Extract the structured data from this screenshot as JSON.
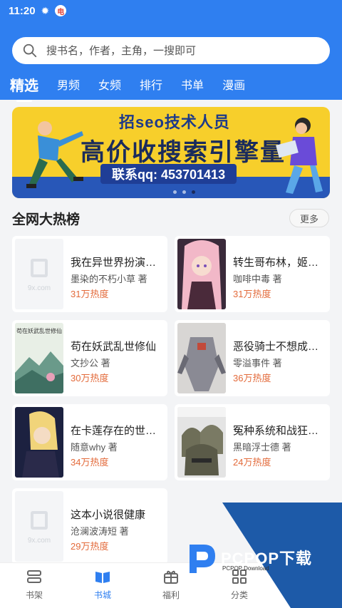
{
  "status": {
    "time": "11:20",
    "icon1": "flame-icon",
    "badge": "电"
  },
  "search": {
    "placeholder": "搜书名，作者，主角，一搜即可"
  },
  "tabs": [
    {
      "label": "精选",
      "active": true
    },
    {
      "label": "男频"
    },
    {
      "label": "女频"
    },
    {
      "label": "排行"
    },
    {
      "label": "书单"
    },
    {
      "label": "漫画"
    }
  ],
  "banner": {
    "line1": "招seo技术人员",
    "line2": "高价收搜索引擎量",
    "line3": "联系qq: 453701413",
    "dots": 3,
    "active_dot": 2
  },
  "section": {
    "title": "全网大热榜",
    "more": "更多"
  },
  "books": [
    {
      "title": "我在异世界扮演动...",
      "author": "墨染的不朽小草 著",
      "heat": "31万热度",
      "cover": "placeholder",
      "ph": "9x.com"
    },
    {
      "title": "转生哥布林，姬骑...",
      "author": "咖啡中毒 著",
      "heat": "31万热度",
      "cover": "anime-girl"
    },
    {
      "title": "苟在妖武乱世修仙",
      "author": "文抄公 著",
      "heat": "30万热度",
      "cover": "landscape",
      "cover_text": "苟在妖武乱世修仙"
    },
    {
      "title": "恶役骑士不想成为...",
      "author": "零溢事件 著",
      "heat": "36万热度",
      "cover": "mecha"
    },
    {
      "title": "在卡莲存在的世界...",
      "author": "随意why 著",
      "heat": "34万热度",
      "cover": "blonde-anime"
    },
    {
      "title": "冤种系统和战狂的...",
      "author": "黑暗浮士德 著",
      "heat": "24万热度",
      "cover": "helmets"
    },
    {
      "title": "这本小说很健康",
      "author": "沧澜波涛短 著",
      "heat": "29万热度",
      "cover": "placeholder",
      "ph": "9x.com"
    }
  ],
  "nav": [
    {
      "label": "书架",
      "icon": "bookshelf-icon"
    },
    {
      "label": "书城",
      "icon": "book-store-icon",
      "active": true
    },
    {
      "label": "福利",
      "icon": "gift-icon"
    },
    {
      "label": "分类",
      "icon": "category-grid-icon"
    }
  ],
  "watermark": {
    "text": "PCPOP下载",
    "sub": "PCPOP Download"
  },
  "colors": {
    "primary": "#2f7ff0",
    "heat": "#e36a3a",
    "banner_yellow": "#f7cf2b"
  }
}
